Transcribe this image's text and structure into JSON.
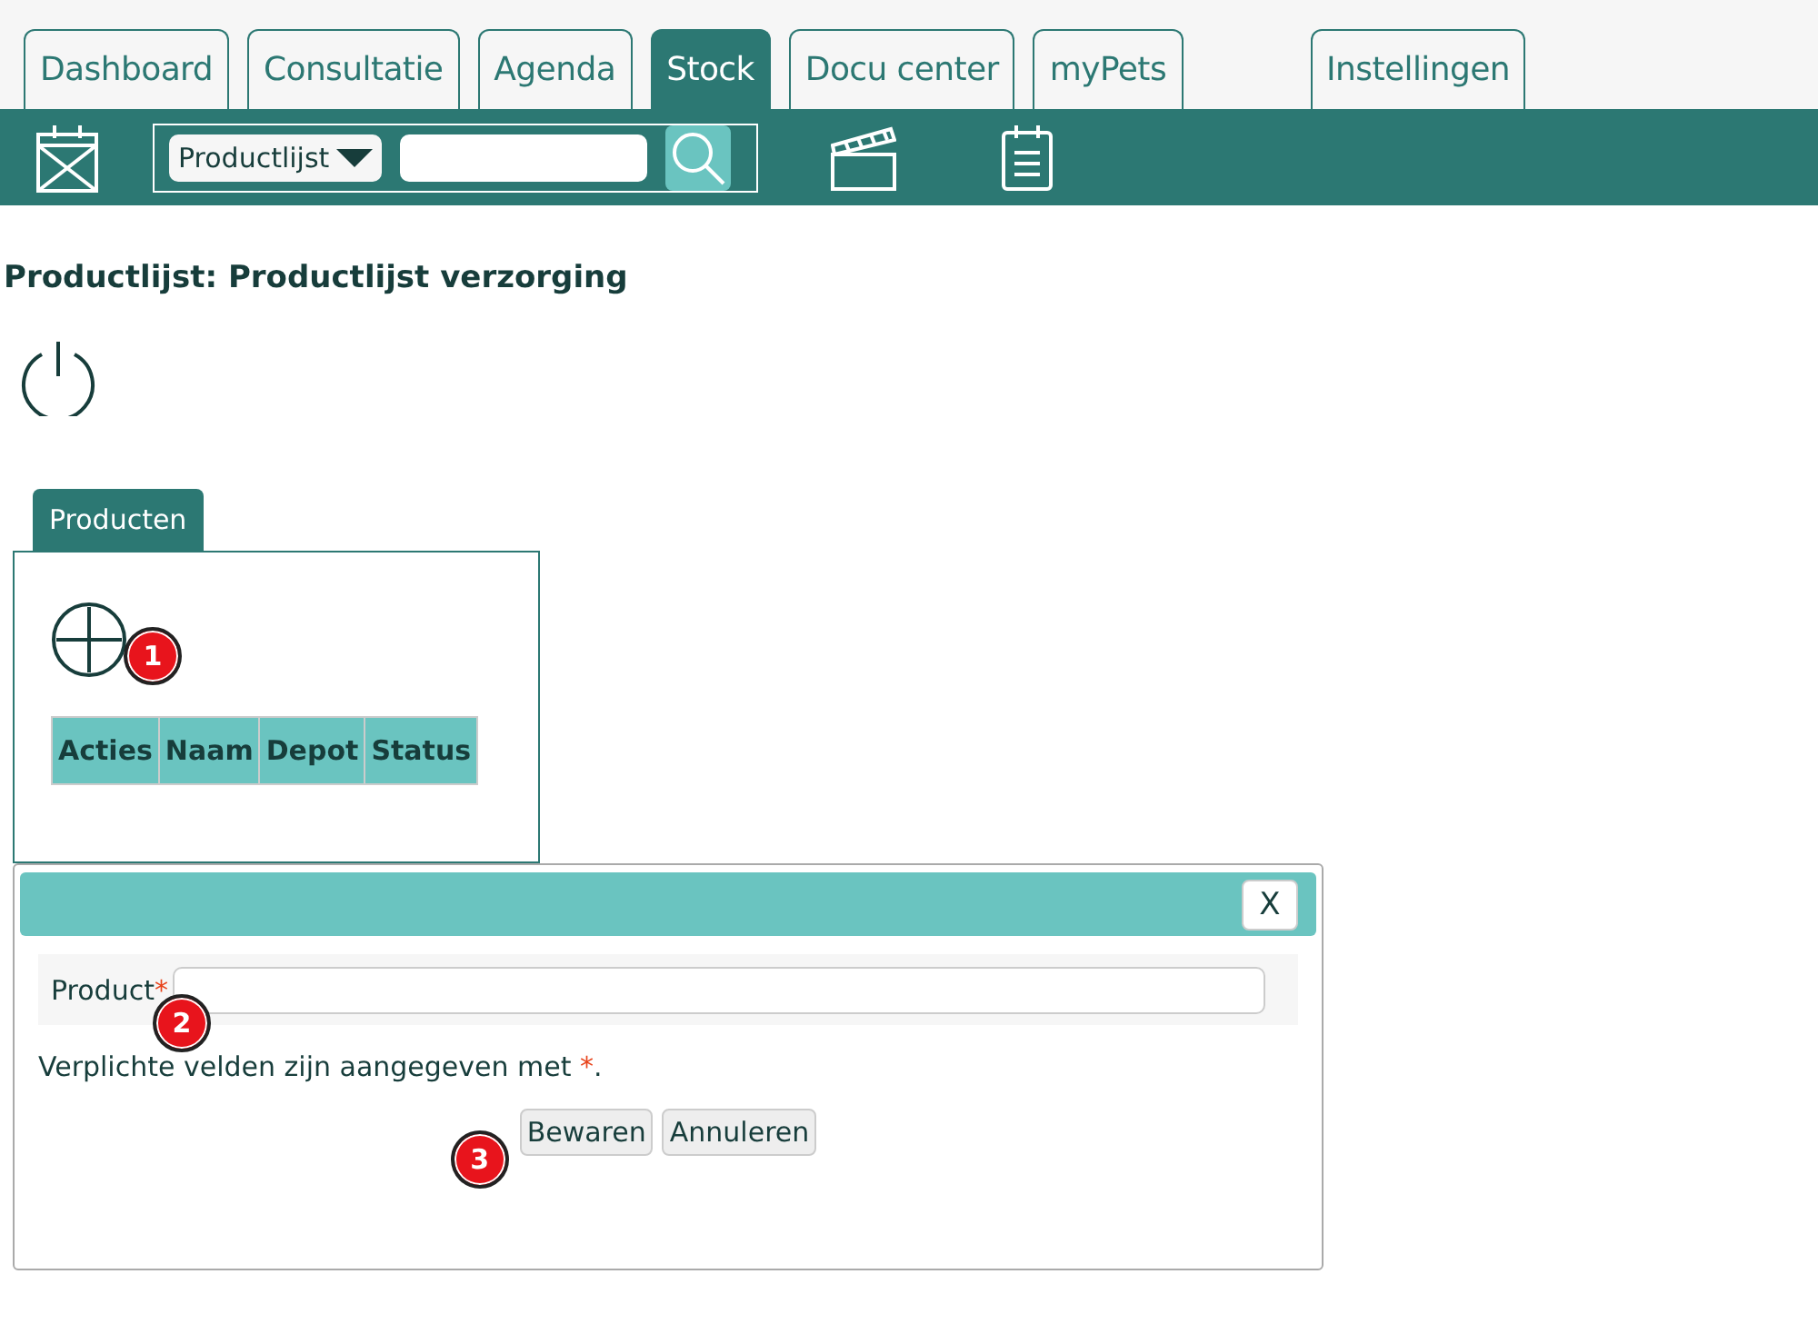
{
  "tabs": [
    {
      "label": "Dashboard",
      "selected": false,
      "kind": "main"
    },
    {
      "label": "Consultatie",
      "selected": false,
      "kind": "main"
    },
    {
      "label": "Agenda",
      "selected": false,
      "kind": "main"
    },
    {
      "label": "Stock",
      "selected": true,
      "kind": "main"
    },
    {
      "label": "Docu center",
      "selected": false,
      "kind": "main"
    },
    {
      "label": "myPets",
      "selected": false,
      "kind": "main"
    },
    {
      "label": "Instellingen",
      "selected": false,
      "kind": "settings"
    }
  ],
  "toolbar": {
    "dropdown": "Productlijst"
  },
  "title": "Productlijst: Productlijst verzorging",
  "subtabs": [
    {
      "label": "Producten",
      "selected": true
    }
  ],
  "table": {
    "columns": [
      "Acties",
      "Naam",
      "Depot",
      "Status"
    ]
  },
  "dialog": {
    "close": "X",
    "field_label": "Product",
    "required_mark": "*",
    "note": "Verplichte velden zijn aangegeven met *.",
    "buttons": [
      "Bewaren",
      "Annuleren"
    ]
  },
  "callouts": [
    "1",
    "2",
    "3"
  ]
}
